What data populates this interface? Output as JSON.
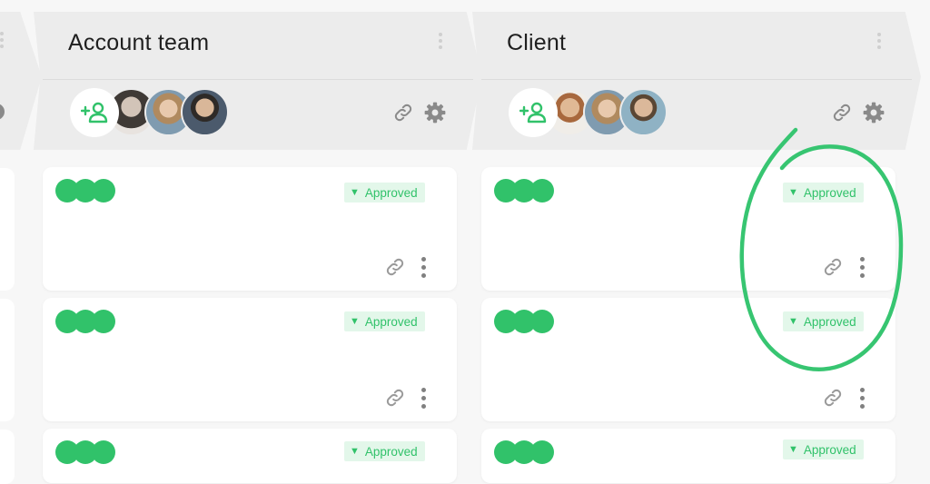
{
  "columns": [
    {
      "title": "Account team",
      "cards": [
        {
          "status": "Approved"
        },
        {
          "status": "Approved"
        },
        {
          "status": "Approved"
        }
      ]
    },
    {
      "title": "Client",
      "cards": [
        {
          "status": "Approved"
        },
        {
          "status": "Approved"
        },
        {
          "status": "Approved"
        }
      ]
    }
  ],
  "colors": {
    "accent": "#31c26a",
    "badge_bg": "#e3f7ea",
    "header_bg": "#ececec",
    "icon_gray": "#8a8a8a",
    "annotation": "#37c571"
  },
  "icons": [
    "add-user-icon",
    "link-icon",
    "gear-icon",
    "kebab-icon",
    "chevron-down-icon"
  ]
}
